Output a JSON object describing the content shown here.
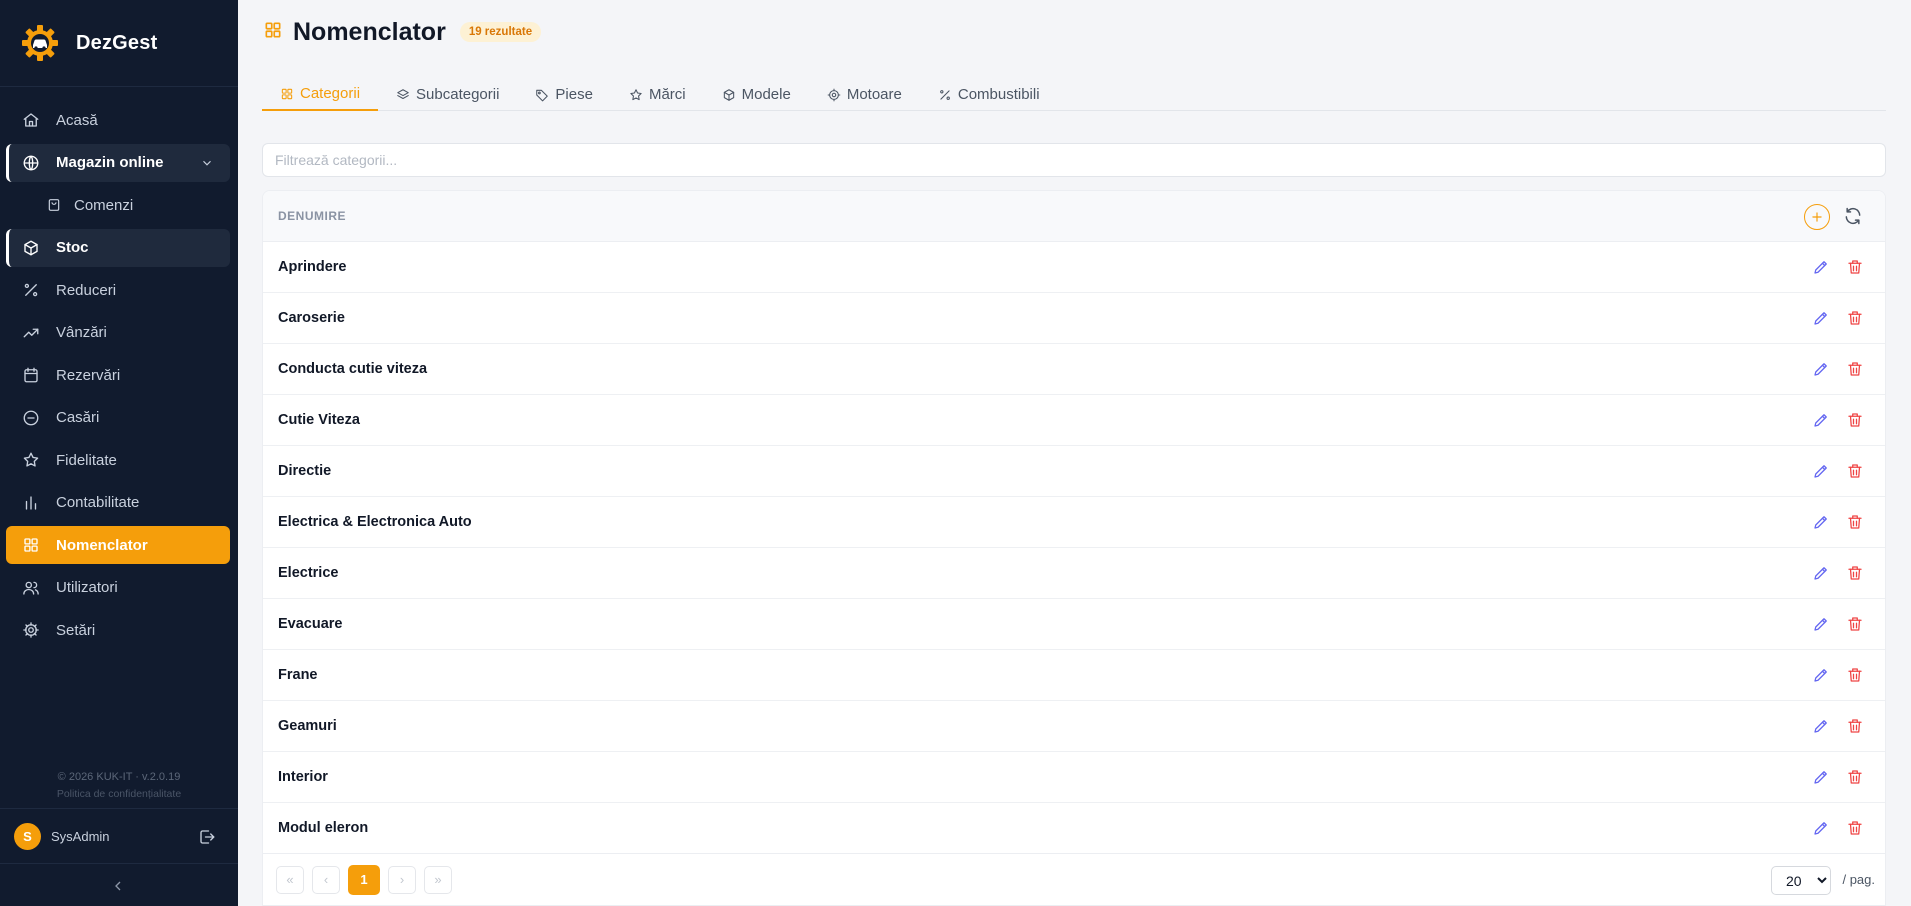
{
  "app": {
    "name": "DezGest"
  },
  "sidebar": {
    "items": [
      {
        "key": "acasa",
        "label": "Acasă",
        "icon": "home-icon"
      },
      {
        "key": "magazin",
        "label": "Magazin online",
        "icon": "globe-icon"
      },
      {
        "key": "comenzi",
        "label": "Comenzi",
        "icon": "bag-icon"
      },
      {
        "key": "stoc",
        "label": "Stoc",
        "icon": "box-icon"
      },
      {
        "key": "reduceri",
        "label": "Reduceri",
        "icon": "percent-icon"
      },
      {
        "key": "vanzari",
        "label": "Vânzări",
        "icon": "trending-up-icon"
      },
      {
        "key": "rezervari",
        "label": "Rezervări",
        "icon": "calendar-icon"
      },
      {
        "key": "casari",
        "label": "Casări",
        "icon": "minus-circle-icon"
      },
      {
        "key": "fidelitate",
        "label": "Fidelitate",
        "icon": "star-icon"
      },
      {
        "key": "contabilitate",
        "label": "Contabilitate",
        "icon": "bar-chart-icon"
      },
      {
        "key": "nomenclator",
        "label": "Nomenclator",
        "icon": "grid-icon"
      },
      {
        "key": "utilizatori",
        "label": "Utilizatori",
        "icon": "users-icon"
      },
      {
        "key": "setari",
        "label": "Setări",
        "icon": "gear-icon"
      }
    ],
    "footer": {
      "copyright": "© 2026 KUK-IT · v.2.0.19",
      "privacy": "Politica de confidențialitate"
    },
    "user": {
      "initial": "S",
      "name": "SysAdmin"
    }
  },
  "header": {
    "title": "Nomenclator",
    "badge": "19 rezultate"
  },
  "tabs": [
    {
      "label": "Categorii",
      "icon": "grid-icon",
      "active": true
    },
    {
      "label": "Subcategorii",
      "icon": "layers-icon",
      "active": false
    },
    {
      "label": "Piese",
      "icon": "tag-icon",
      "active": false
    },
    {
      "label": "Mărci",
      "icon": "star-icon",
      "active": false
    },
    {
      "label": "Modele",
      "icon": "box-icon",
      "active": false
    },
    {
      "label": "Motoare",
      "icon": "gear-icon",
      "active": false
    },
    {
      "label": "Combustibili",
      "icon": "percent-icon",
      "active": false
    }
  ],
  "filter": {
    "placeholder": "Filtrează categorii..."
  },
  "table": {
    "header": "DENUMIRE",
    "rows": [
      "Aprindere",
      "Caroserie",
      "Conducta cutie viteza",
      "Cutie Viteza",
      "Directie",
      "Electrica & Electronica Auto",
      "Electrice",
      "Evacuare",
      "Frane",
      "Geamuri",
      "Interior",
      "Modul eleron"
    ]
  },
  "pagination": {
    "first": "«",
    "prev": "‹",
    "current": "1",
    "next": "›",
    "last": "»",
    "per_page": "20",
    "per_page_label": "/ pag."
  },
  "colors": {
    "accent": "#f59e0b",
    "sidebar_bg": "#111b2e",
    "edit": "#6366f1",
    "delete": "#ef4444"
  }
}
